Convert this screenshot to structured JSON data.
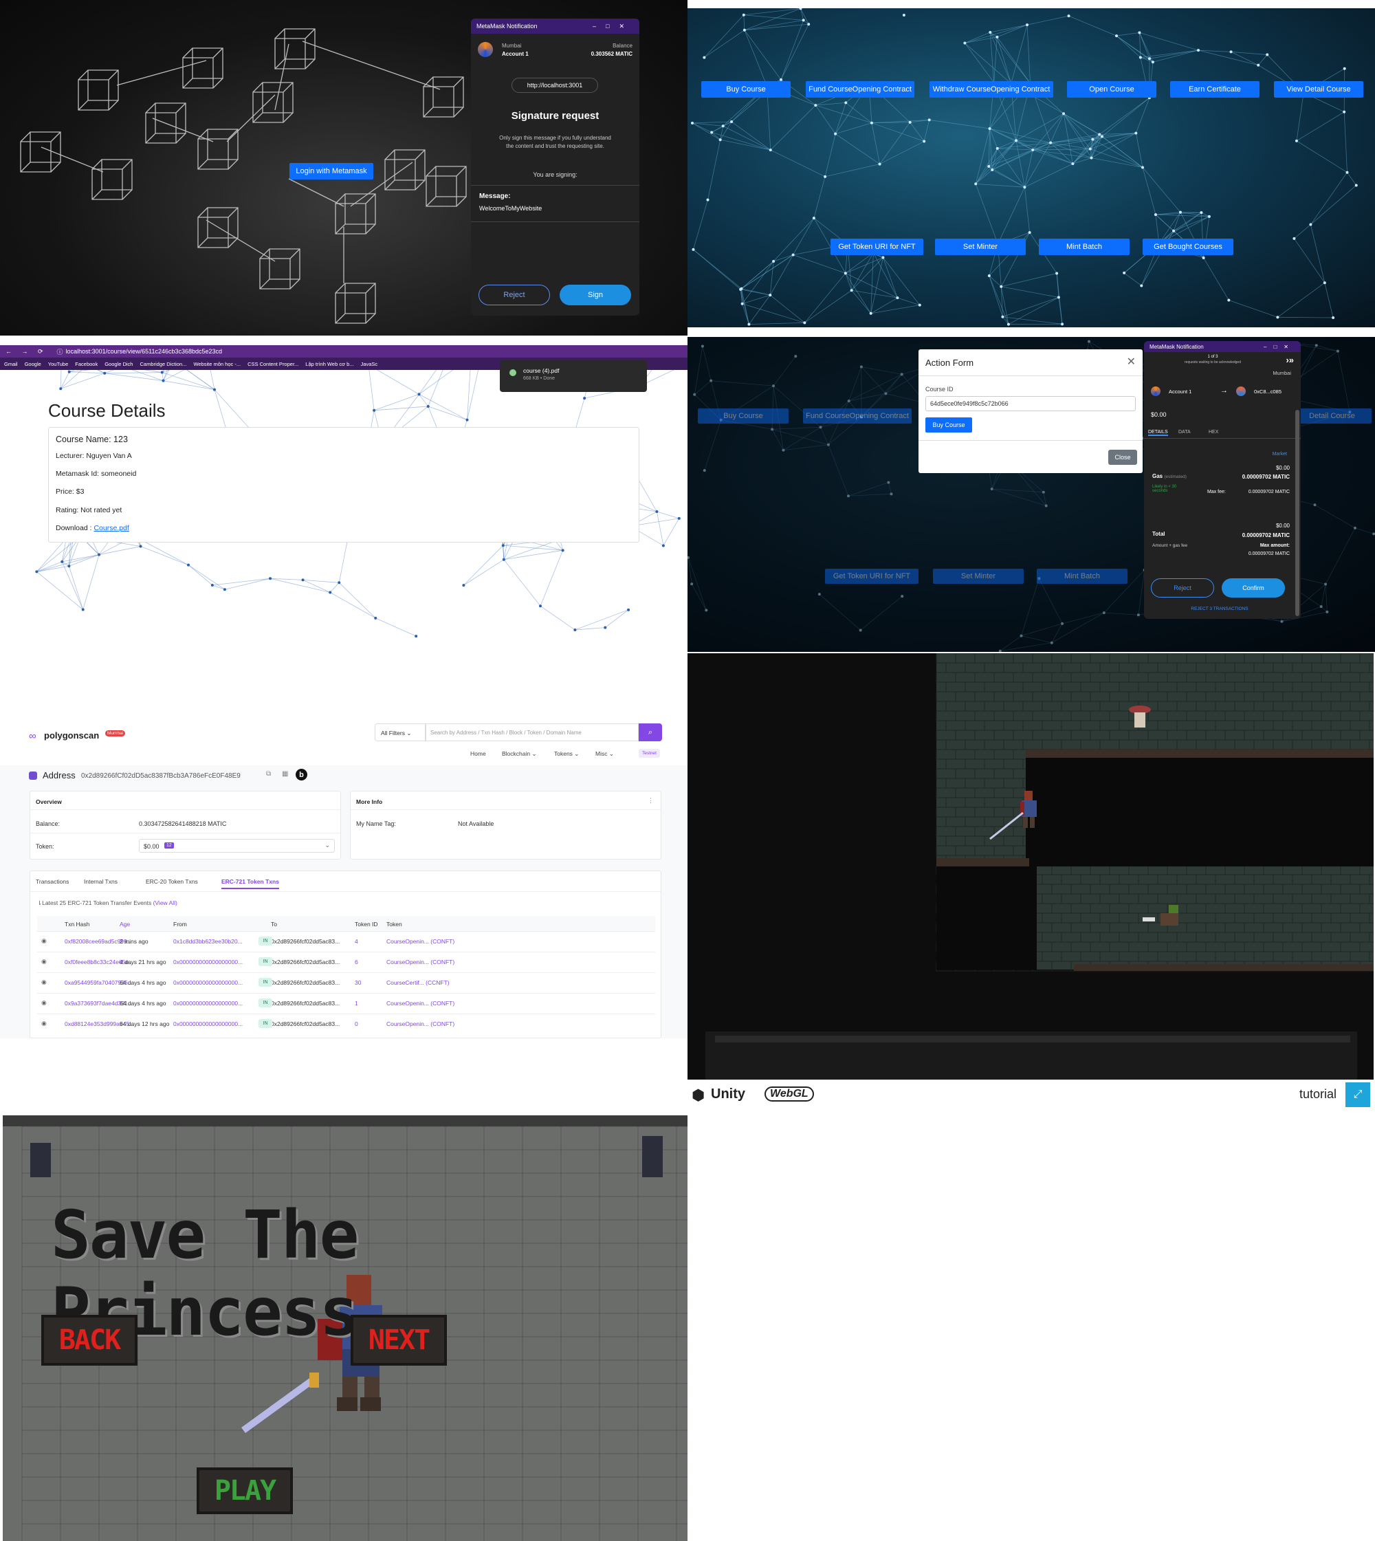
{
  "panel1": {
    "login_button": "Login with Metamask",
    "metamask": {
      "header_title": "MetaMask Notification",
      "network": "Mumbai",
      "account": "Account 1",
      "balance_label": "Balance",
      "balance_value": "0.303562 MATIC",
      "origin": "http://localhost:3001",
      "title": "Signature request",
      "warning": "Only sign this message if you fully understand the content and trust the requesting site.",
      "you_are_signing": "You are signing:",
      "message_label": "Message:",
      "message_value": "WelcomeToMyWebsite",
      "reject": "Reject",
      "sign": "Sign"
    }
  },
  "panel2": {
    "row1": [
      "Buy Course",
      "Fund CourseOpening Contract",
      "Withdraw CourseOpening Contract",
      "Open Course",
      "Earn Certificate",
      "View Detail Course"
    ],
    "row2": [
      "Get Token URI for NFT",
      "Set Minter",
      "Mint Batch",
      "Get Bought Courses"
    ]
  },
  "panel3": {
    "url": "localhost:3001/course/view/6511c246cb3c368bdc5e23cd",
    "bookmarks": [
      "Gmail",
      "Google",
      "YouTube",
      "Facebook",
      "Google Dich",
      "Cambridge Diction...",
      "Website môn học -...",
      "CSS Content Proper...",
      "Lập trình Web cơ b...",
      "JavaSc"
    ],
    "download_name": "course (4).pdf",
    "download_info": "668 KB • Done",
    "heading": "Course Details",
    "course_name": "Course Name: 123",
    "lecturer": "Lecturer: Nguyen Van A",
    "metamask_id": "Metamask Id: someoneid",
    "price": "Price: $3",
    "rating": "Rating: Not rated yet",
    "download_label": "Download :",
    "download_link": "Course.pdf"
  },
  "panel4": {
    "row1": [
      "Buy Course",
      "Fund CourseOpening Contract",
      "Detail Course"
    ],
    "row2": [
      "Get Token URI for NFT",
      "Set Minter",
      "Mint Batch"
    ],
    "form_title": "Action Form",
    "course_id_label": "Course ID",
    "course_id_value": "64d5ece0fe949f8c5c72b066",
    "buy_button": "Buy Course",
    "close_button": "Close",
    "mm_header": "MetaMask Notification",
    "mm_count": "1 of 3",
    "mm_waiting": "requests waiting to be acknowledged",
    "mm_network": "Mumbai",
    "mm_account": "Account 1",
    "mm_to": "0xC8...c085",
    "mm_value": "$0.00",
    "tabs": [
      "DETAILS",
      "DATA",
      "HEX"
    ],
    "market": "Market",
    "gas_label": "Gas",
    "gas_est": "(estimated)",
    "gas_usd": "$0.00",
    "gas_matic": "0.00009702 MATIC",
    "likely": "Likely in < 30 seconds",
    "max_fee_label": "Max fee:",
    "max_fee": "0.00009702 MATIC",
    "total_label": "Total",
    "total_usd": "$0.00",
    "total_matic": "0.00009702 MATIC",
    "amount_gas": "Amount + gas fee",
    "max_amount_label": "Max amount:",
    "max_amount": "0.00009702 MATIC",
    "reject": "Reject",
    "confirm": "Confirm",
    "reject_all": "REJECT 3 TRANSACTIONS"
  },
  "panel5": {
    "brand": "polygonscan",
    "brand_badge": "Mumbai",
    "filter": "All Filters",
    "search_placeholder": "Search by Address / Txn Hash / Block / Token / Domain Name",
    "nav": [
      "Home",
      "Blockchain",
      "Tokens",
      "Misc"
    ],
    "testnet": "Testnet",
    "address_label": "Address",
    "address": "0x2d89266fCf02dD5ac8387fBcb3A786eFcE0F48E9",
    "overview": "Overview",
    "balance_label": "Balance:",
    "balance": "0.303472582641488218 MATIC",
    "token_label": "Token:",
    "token_value": "$0.00",
    "token_count": "12",
    "more_info": "More Info",
    "name_tag_label": "My Name Tag:",
    "name_tag": "Not Available",
    "tabs": [
      "Transactions",
      "Internal Txns",
      "ERC-20 Token Txns",
      "ERC-721 Token Txns"
    ],
    "latest": "Latest 25 ERC-721 Token Transfer Events",
    "view_all": "(View All)",
    "columns": [
      "Txn Hash",
      "Age",
      "From",
      "To",
      "Token ID",
      "Token"
    ],
    "rows": [
      {
        "hash": "0xf82008cee69ad5c999...",
        "age": "2 mins ago",
        "from": "0x1c8dd3bb623ee30b20...",
        "dir": "IN",
        "to": "0x2d89266fcf02dd5ac83...",
        "id": "4",
        "token": "CourseOpenin... (CONFT)"
      },
      {
        "hash": "0xf0feee8b8c33c24e65e...",
        "age": "4 days 21 hrs ago",
        "from": "0x000000000000000000...",
        "dir": "IN",
        "to": "0x2d89266fcf02dd5ac83...",
        "id": "6",
        "token": "CourseOpenin... (CONFT)"
      },
      {
        "hash": "0xa9544959fa70407936...",
        "age": "64 days 4 hrs ago",
        "from": "0x000000000000000000...",
        "dir": "IN",
        "to": "0x2d89266fcf02dd5ac83...",
        "id": "30",
        "token": "CourseCertif... (CCNFT)"
      },
      {
        "hash": "0x9a373693f7dae4d391...",
        "age": "64 days 4 hrs ago",
        "from": "0x000000000000000000...",
        "dir": "IN",
        "to": "0x2d89266fcf02dd5ac83...",
        "id": "1",
        "token": "CourseOpenin... (CONFT)"
      },
      {
        "hash": "0xd88124e353d999a945...",
        "age": "64 days 12 hrs ago",
        "from": "0x000000000000000000...",
        "dir": "IN",
        "to": "0x2d89266fcf02dd5ac83...",
        "id": "0",
        "token": "CourseOpenin... (CONFT)"
      }
    ]
  },
  "panel6": {
    "unity": "Unity",
    "webgl": "WebGL",
    "title": "tutorial"
  },
  "panel7": {
    "title": "Save The Princess",
    "back": "BACK",
    "next": "NEXT",
    "play": "PLAY"
  }
}
